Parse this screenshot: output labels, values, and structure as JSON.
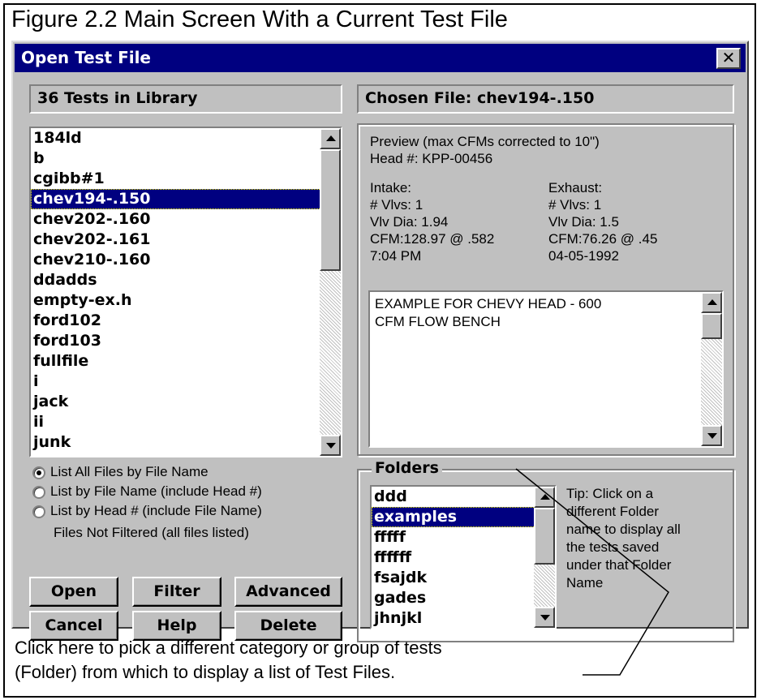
{
  "figure": {
    "title": "Figure 2.2  Main Screen With a Current Test File",
    "caption_line1": "Click here to pick a different  category  or group of tests",
    "caption_line2": "(Folder) from which to display a list of Test Files."
  },
  "dialog": {
    "title": "Open Test File",
    "close_glyph": "✕",
    "library_count_label": "36 Tests in Library",
    "chosen_file_label": "Chosen File: chev194-.150"
  },
  "file_list": {
    "items": [
      "184ld",
      "b",
      "cgibb#1",
      "chev194-.150",
      "chev202-.160",
      "chev202-.161",
      "chev210-.160",
      "ddadds",
      "empty-ex.h",
      "ford102",
      "ford103",
      "fullfile",
      "i",
      "jack",
      "ii",
      "junk"
    ],
    "selected_index": 3
  },
  "list_options": {
    "options": [
      "List All Files by File Name",
      "List by File Name (include Head #)",
      "List by Head # (include File Name)"
    ],
    "selected_index": 0,
    "filter_status": "Files Not Filtered (all files listed)"
  },
  "buttons": {
    "open": "Open",
    "filter": "Filter",
    "advanced": "Advanced",
    "cancel": "Cancel",
    "help": "Help",
    "delete": "Delete"
  },
  "preview": {
    "heading": "Preview  (max CFMs corrected to 10\")",
    "head_number": "Head #: KPP-00456",
    "intake": {
      "label": "Intake:",
      "valves": "# Vlvs: 1",
      "valve_dia": "Vlv Dia: 1.94",
      "cfm": "CFM:128.97 @ .582",
      "time": "7:04 PM"
    },
    "exhaust": {
      "label": "Exhaust:",
      "valves": "# Vlvs: 1",
      "valve_dia": "Vlv Dia: 1.5",
      "cfm": "CFM:76.26 @ .45",
      "date": "04-05-1992"
    },
    "comment_line1": "EXAMPLE FOR CHEVY HEAD - 600",
    "comment_line2": "CFM FLOW BENCH"
  },
  "folders": {
    "label": "Folders",
    "items": [
      "ddd",
      "examples",
      "fffff",
      "ffffff",
      "fsajdk",
      "gades",
      "jhnjkl"
    ],
    "selected_index": 1,
    "tip_lines": [
      "Tip:  Click on a",
      "different Folder",
      "name to display all",
      "the tests saved",
      "under that Folder",
      "Name"
    ]
  },
  "icons": {
    "close": "close-icon",
    "scroll_up": "arrow-up-icon",
    "scroll_down": "arrow-down-icon"
  },
  "colors": {
    "title_bar": "#000080",
    "dialog_face": "#c0c0c0",
    "selection": "#000080"
  }
}
